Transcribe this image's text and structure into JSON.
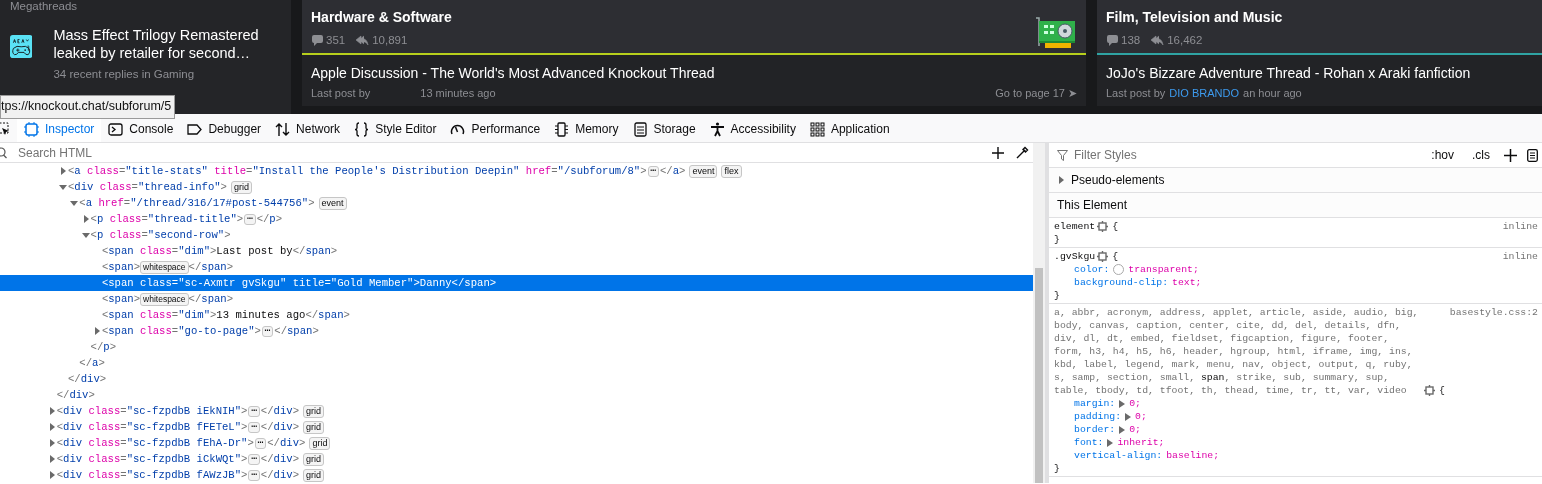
{
  "forum": {
    "left": {
      "heading": "Megathreads",
      "thread": {
        "title": "Mass Effect Trilogy Remastered leaked by retailer for second…",
        "meta": "34 recent replies in Gaming"
      }
    },
    "subforums": [
      {
        "title": "Hardware & Software",
        "threads": "351",
        "replies": "10,891",
        "color": "#b7cf1c",
        "thread": "Apple Discussion - The World's Most Advanced Knockout Thread",
        "last_post_label": "Last post by",
        "time": "13 minutes ago",
        "go_to_page": "Go to page 17 ➤"
      },
      {
        "title": "Film, Television and Music",
        "threads": "138",
        "replies": "16,462",
        "color": "#2fa3a3",
        "thread": "JoJo's Bizzare Adventure Thread - Rohan x Araki fanfiction",
        "last_post_label": "Last post by",
        "author": "DIO BRANDO",
        "time": "an hour ago"
      }
    ]
  },
  "tooltip": "tps://knockout.chat/subforum/5",
  "devtools": {
    "tabs": [
      {
        "selected": false
      },
      {
        "label": "Inspector",
        "selected": true
      },
      {
        "label": "Console",
        "selected": false
      },
      {
        "label": "Debugger",
        "selected": false
      },
      {
        "label": "Network",
        "selected": false
      },
      {
        "label": "Style Editor",
        "selected": false
      },
      {
        "label": "Performance",
        "selected": false
      },
      {
        "label": "Memory",
        "selected": false
      },
      {
        "label": "Storage",
        "selected": false
      },
      {
        "label": "Accessibility",
        "selected": false
      },
      {
        "label": "Application",
        "selected": false
      }
    ],
    "markup": {
      "search_placeholder": "Search HTML",
      "tree": [
        {
          "close": "</div>",
          "children": [
            {
              "open": "<a class=\"title-stats\" title=\"Install the People's Distribution Deepin\" href=\"/subforum/8\">",
              "expanded": false,
              "ellipsis": "⋯",
              "close": "</a>",
              "badges": [
                "event",
                "flex"
              ],
              "selected": false
            },
            {
              "open": "<div class=\"thread-info\">",
              "badges": [
                "grid"
              ],
              "expanded": true,
              "selected": false,
              "close": "</div>",
              "children": [
                {
                  "open": "<a href=\"/thread/316/17#post-544756\">",
                  "badges": [
                    "event"
                  ],
                  "expanded": true,
                  "selected": false,
                  "close": "</a>",
                  "children": [
                    {
                      "open": "<p class=\"thread-title\">",
                      "expanded": false,
                      "ellipsis": "⋯",
                      "close": "</p>",
                      "selected": false
                    },
                    {
                      "open": "<p class=\"second-row\">",
                      "expanded": true,
                      "close": "</p>",
                      "selected": false,
                      "children": [
                        {
                          "open": "<span class=\"dim\">",
                          "text": "Last post by",
                          "close": "</span>",
                          "selected": false
                        },
                        {
                          "open": "<span>",
                          "inline_badge": "whitespace",
                          "close": "</span>",
                          "selected": false
                        },
                        {
                          "open": "<span class=\"sc-Axmtr gvSkgu\" title=\"Gold Member\">",
                          "text": "Danny",
                          "close": "</span>",
                          "selected": true
                        },
                        {
                          "open": "<span>",
                          "inline_badge": "whitespace",
                          "close": "</span>",
                          "selected": false
                        },
                        {
                          "open": "<span class=\"dim\">",
                          "text": "13 minutes ago",
                          "close": "</span>",
                          "selected": false
                        },
                        {
                          "open": "<span class=\"go-to-page\">",
                          "expanded": false,
                          "ellipsis": "⋯",
                          "close": "</span>",
                          "selected": false
                        }
                      ]
                    }
                  ]
                }
              ]
            }
          ]
        },
        {
          "open": "<div class=\"sc-fzpdbB iEkNIH\">",
          "expanded": false,
          "ellipsis": "⋯",
          "close": "</div>",
          "badges": [
            "grid"
          ],
          "selected": false
        },
        {
          "open": "<div class=\"sc-fzpdbB fFETeL\">",
          "expanded": false,
          "ellipsis": "⋯",
          "close": "</div>",
          "badges": [
            "grid"
          ],
          "selected": false
        },
        {
          "open": "<div class=\"sc-fzpdbB fEhA-Dr\">",
          "expanded": false,
          "ellipsis": "⋯",
          "close": "</div>",
          "badges": [
            "grid"
          ],
          "selected": false
        },
        {
          "open": "<div class=\"sc-fzpdbB iCkWQt\">",
          "expanded": false,
          "ellipsis": "⋯",
          "close": "</div>",
          "badges": [
            "grid"
          ],
          "selected": false
        },
        {
          "open": "<div class=\"sc-fzpdbB fAWzJB\">",
          "expanded": false,
          "ellipsis": "⋯",
          "close": "</div>",
          "badges": [
            "grid"
          ],
          "selected": false
        }
      ]
    },
    "rules": {
      "filter_placeholder": "Filter Styles",
      "hov": ":hov",
      "cls": ".cls",
      "pseudo_elements": {
        "label": "Pseudo-elements",
        "expanded": false
      },
      "this_element": "This Element",
      "list": [
        {
          "selector": [
            {
              "text": "element",
              "matched": true
            }
          ],
          "source": "inline",
          "open": "{",
          "close": "}"
        },
        {
          "selector": [
            {
              "text": ".gvSkgu",
              "matched": true
            }
          ],
          "source": "inline",
          "open": "{",
          "close": "}",
          "declarations": [
            {
              "kind": "color",
              "property": "color:",
              "value": "transparent;"
            },
            {
              "kind": "plain",
              "property": "background-clip:",
              "value": "text;"
            }
          ]
        },
        {
          "selector": [
            {
              "text": "a, abbr, acronym, address, applet, article, aside, audio, big, body, canvas, caption, center, cite, dd, del, details, dfn, div, dl, dt, embed, fieldset, figcaption, figure, footer, form, h3, h4, h5, h6, header, hgroup, html, iframe, img, ins, kbd, label, legend, mark, menu, nav, object, output, q, ruby, s, samp, section, small, ",
              "matched": false
            },
            {
              "text": "span",
              "matched": true
            },
            {
              "text": ", strike, sub, summary, sup, table, tbody, td, tfoot, th, thead, time, tr, tt, var, video",
              "matched": false
            }
          ],
          "source": "basestyle.css:2",
          "open": "{",
          "close": "}",
          "declarations": [
            {
              "kind": "shorthand",
              "property": "margin:",
              "value": "0;"
            },
            {
              "kind": "shorthand",
              "property": "padding:",
              "value": "0;"
            },
            {
              "kind": "shorthand",
              "property": "border:",
              "value": "0;"
            },
            {
              "kind": "shorthand",
              "property": "font:",
              "value": "inherit;"
            },
            {
              "kind": "plain",
              "property": "vertical-align:",
              "value": "baseline;"
            }
          ]
        }
      ]
    }
  }
}
